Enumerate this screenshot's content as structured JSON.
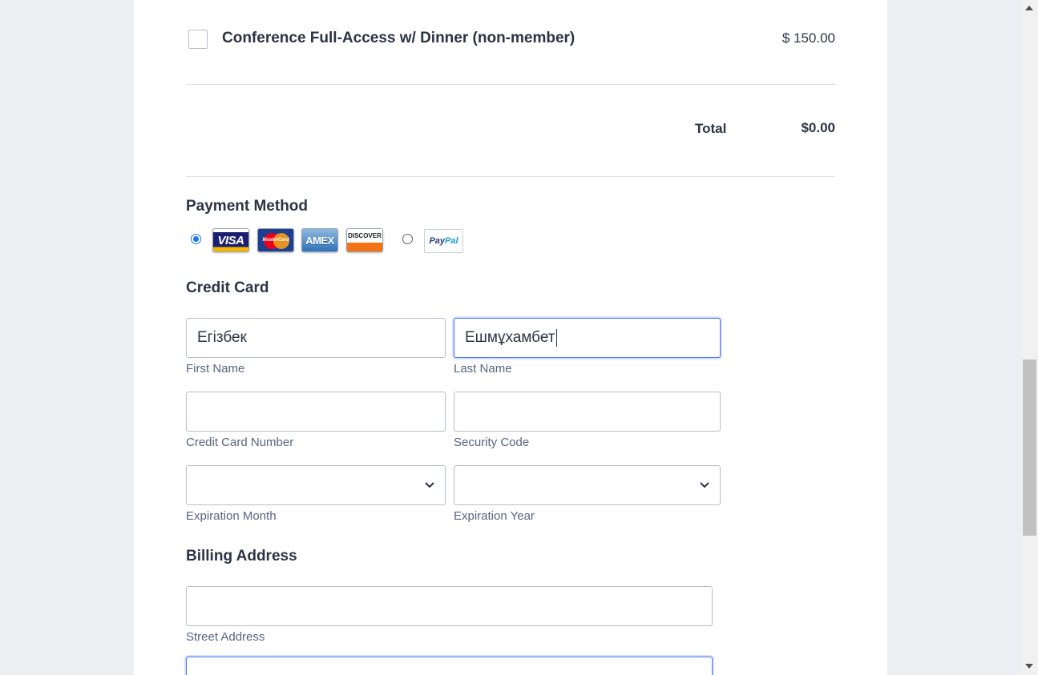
{
  "product": {
    "name": "Conference Full-Access w/ Dinner (non-member)",
    "price": "$ 150.00"
  },
  "total": {
    "label": "Total",
    "value": "$0.00"
  },
  "payment": {
    "title": "Payment Method",
    "options": [
      {
        "type": "credit-card",
        "selected": true,
        "logos": [
          "VISA",
          "MasterCard",
          "AMEX",
          "DISCOVER"
        ]
      },
      {
        "type": "paypal",
        "selected": false,
        "logo_text_1": "Pay",
        "logo_text_2": "Pal"
      }
    ]
  },
  "credit_card": {
    "title": "Credit Card",
    "first_name": {
      "value": "Егізбек",
      "label": "First Name"
    },
    "last_name": {
      "value": "Ешмұхамбет",
      "label": "Last Name"
    },
    "card_number": {
      "value": "",
      "label": "Credit Card Number"
    },
    "security_code": {
      "value": "",
      "label": "Security Code"
    },
    "exp_month": {
      "value": "",
      "label": "Expiration Month"
    },
    "exp_year": {
      "value": "",
      "label": "Expiration Year"
    }
  },
  "billing": {
    "title": "Billing Address",
    "street": {
      "value": "",
      "label": "Street Address"
    }
  },
  "colors": {
    "accent": "#4a74f0",
    "radio": "#1a73e8",
    "text": "#2c3345",
    "sublabel": "#57647e"
  }
}
